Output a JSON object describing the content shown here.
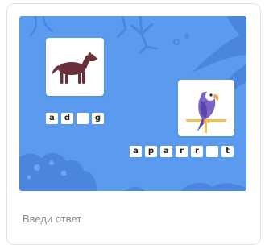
{
  "task": {
    "words": [
      {
        "picture": "dog",
        "tiles": [
          "a",
          "d",
          "",
          "g"
        ]
      },
      {
        "picture": "parrot",
        "tiles": [
          "a",
          "p",
          "a",
          "r",
          "r",
          "",
          "t"
        ]
      }
    ]
  },
  "answer": {
    "placeholder": "Введи ответ",
    "value": ""
  },
  "colors": {
    "scene_background": "#5a9bef",
    "scene_decor": "#4a85db",
    "dog": "#6b2f3a",
    "parrot": "#7a64c6"
  },
  "icons": [
    "dog-icon",
    "parrot-icon",
    "coral-decor-icon",
    "seaweed-decor-icon"
  ]
}
